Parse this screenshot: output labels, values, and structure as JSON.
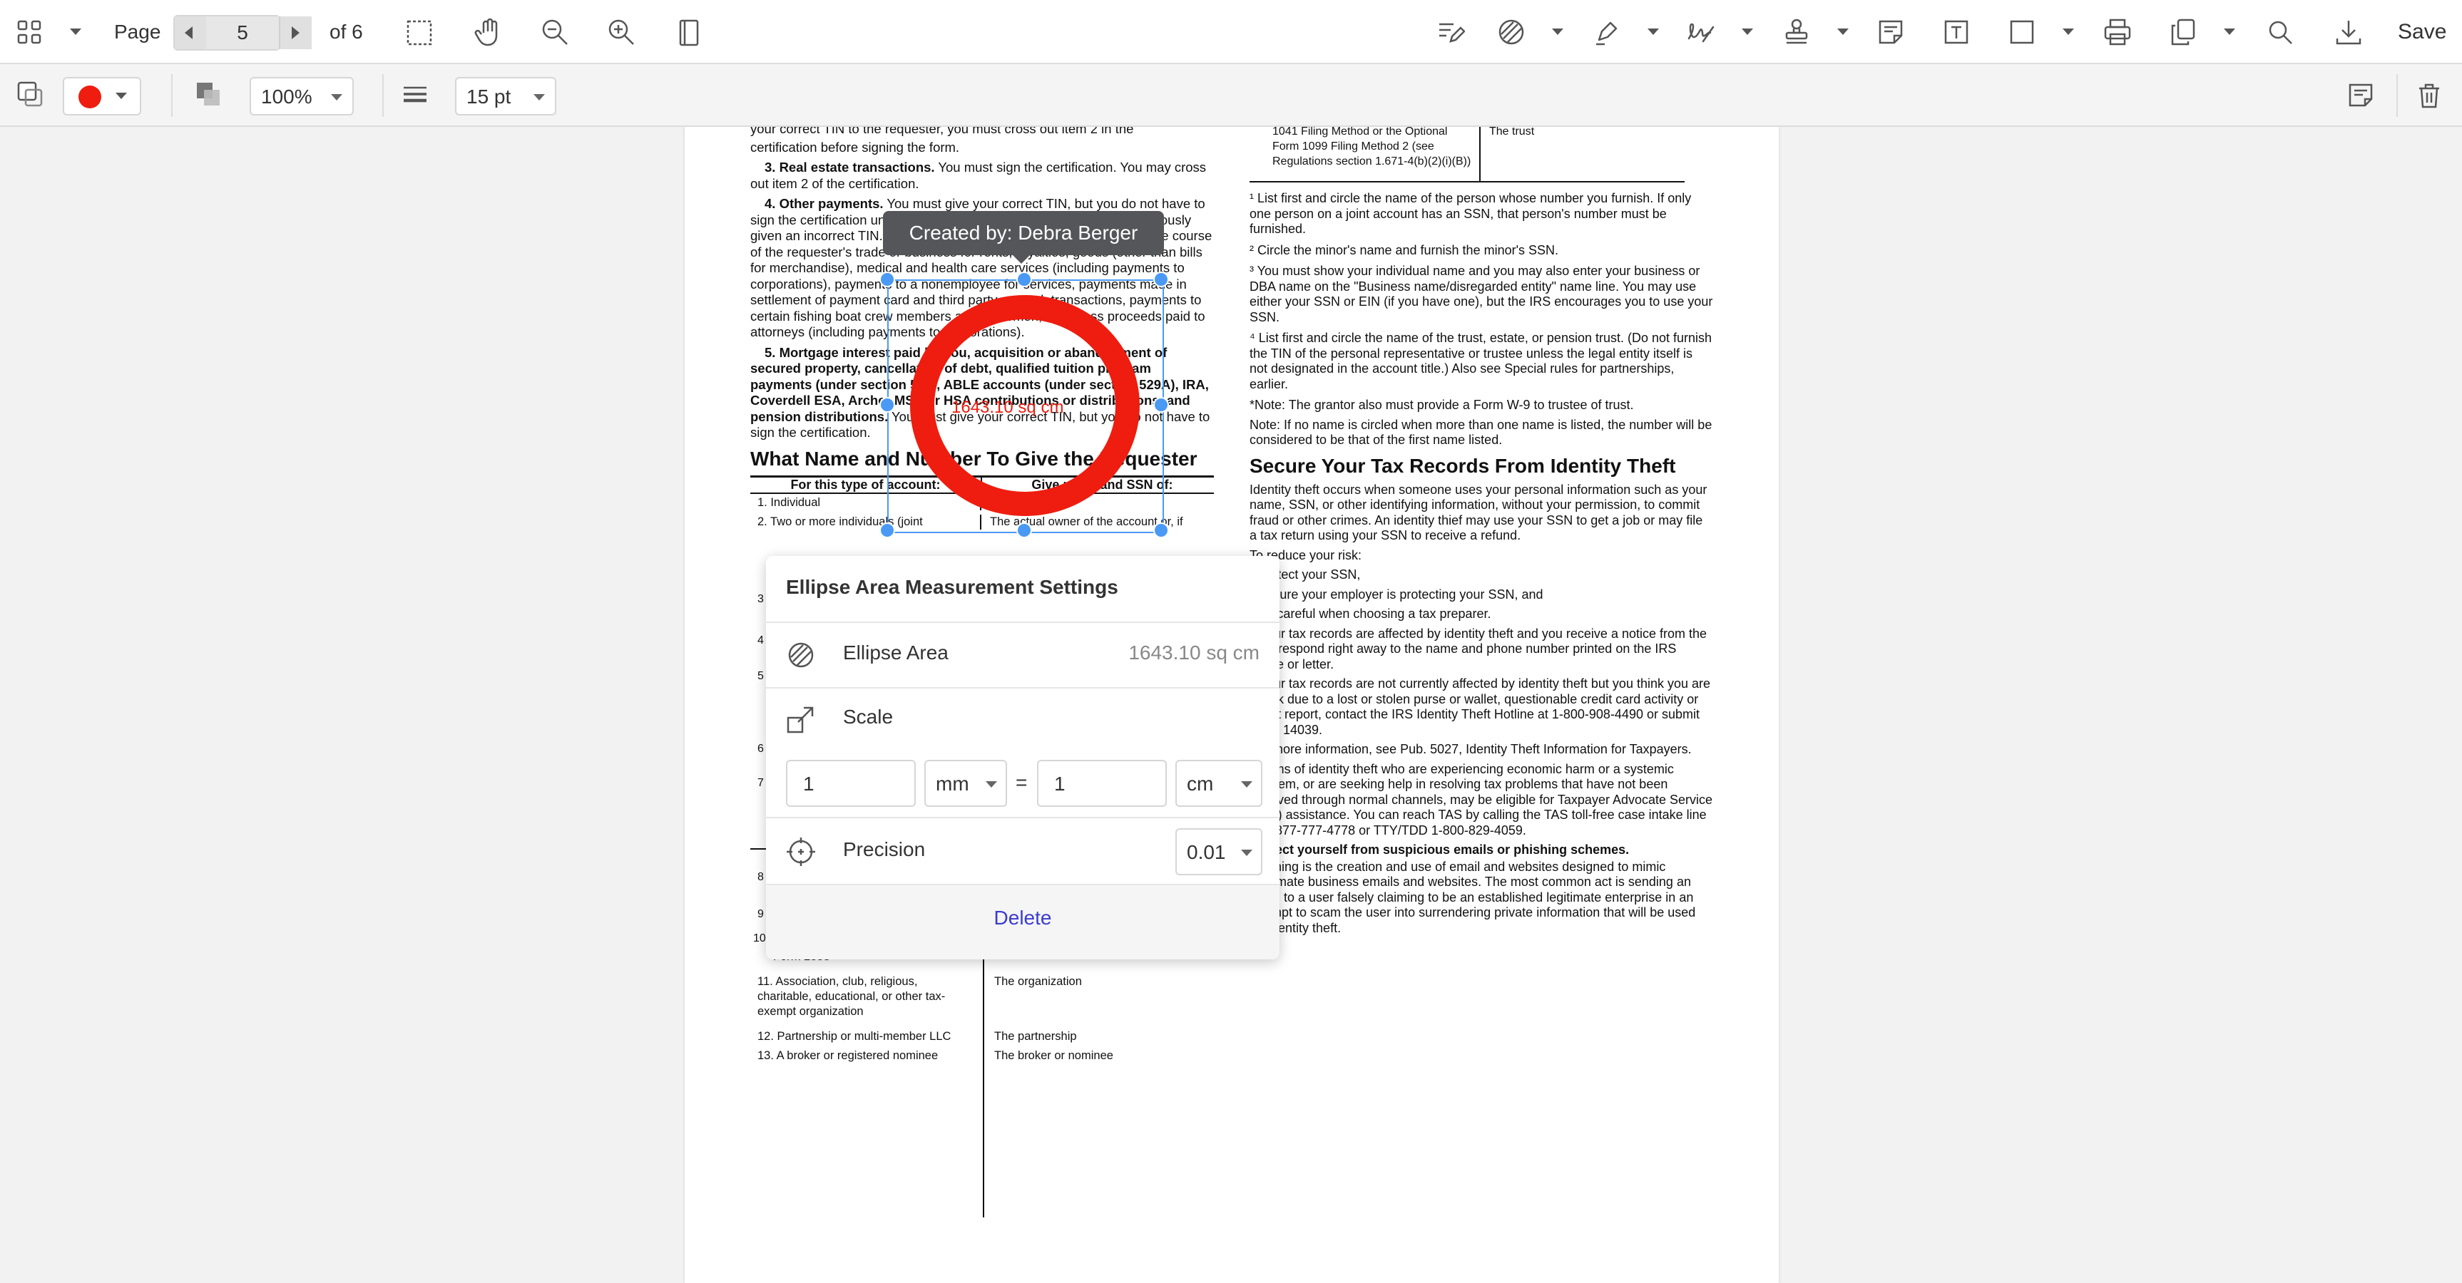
{
  "toolbar": {
    "page_label": "Page",
    "page_value": "5",
    "page_total": "of 6",
    "save_label": "Save"
  },
  "subtoolbar": {
    "stroke_color": "#ee1d0f",
    "opacity_value": "100%",
    "thickness_value": "15 pt"
  },
  "document": {
    "left_col": [
      "your correct TIN to the requester, you must cross out item 2 in the",
      "certification before signing the form."
    ],
    "real_estate_title": "3. Real estate transactions.",
    "real_estate_text": " You must sign the certification. You may cross out item 2 of the certification.",
    "other_payments_title": "4. Other payments.",
    "other_payments_text": " You must give your correct TIN, but you do not have to sign the certification unless you have been notified that you have previously given an incorrect TIN. \"Other payments\" include payments made in the course of the requester's trade or business for rents, royalties, goods (other than bills for merchandise), medical and health care services (including payments to corporations), payments to a nonemployee for services, payments made in settlement of payment card and third party network transactions, payments to certain fishing boat crew members and fishermen, and gross proceeds paid to attorneys (including payments to corporations).",
    "mortgage_title": "5. Mortgage interest paid by you, acquisition or abandonment of secured property, cancellation of debt, qualified tuition program payments (under section 529), ABLE accounts (under section 529A), IRA, Coverdell ESA, Archer MSA or HSA contributions or distributions, and pension distributions.",
    "mortgage_text": " You must give your correct TIN, but you do not have to sign the certification.",
    "what_name_heading": "What Name and Number To Give the Requester",
    "table_head_1": "For this type of account:",
    "table_head_2": "Give name and SSN of:",
    "table_rows": [
      {
        "a": "1. Individual",
        "b": "The individual"
      },
      {
        "a": "2. Two or more individuals (joint",
        "b": "The actual owner of the account or, if"
      }
    ],
    "table_rows_lower": [
      {
        "a": "Form 2553",
        "b": ""
      },
      {
        "a": "11. Association, club, religious, charitable, educational, or other tax-exempt organization",
        "b": "The organization"
      },
      {
        "a": "12. Partnership or multi-member LLC",
        "b": "The partnership"
      },
      {
        "a": "13. A broker or registered nominee",
        "b": "The broker or nominee"
      }
    ],
    "right_top": "1041 Filing Method or the Optional Form 1099 Filing Method 2 (see Regulations section 1.671-4(b)(2)(i)(B))",
    "right_top_col2": "The trust",
    "note1": "¹ List first and circle the name of the person whose number you furnish. If only one person on a joint account has an SSN, that person's number must be furnished.",
    "note2": "² Circle the minor's name and furnish the minor's SSN.",
    "note3": "³ You must show your individual name and you may also enter your business or DBA name on the \"Business name/disregarded entity\" name line. You may use either your SSN or EIN (if you have one), but the IRS encourages you to use your SSN.",
    "note4": "⁴ List first and circle the name of the trust, estate, or pension trust. (Do not furnish the TIN of the personal representative or trustee unless the legal entity itself is not designated in the account title.) Also see Special rules for partnerships, earlier.",
    "note5": "*Note: The grantor also must provide a Form W-9 to trustee of trust.",
    "note6": "Note: If no name is circled when more than one name is listed, the number will be considered to be that of the first name listed.",
    "secure_heading": "Secure Your Tax Records From Identity Theft",
    "secure_p1": "Identity theft occurs when someone uses your personal information such as your name, SSN, or other identifying information, without your permission, to commit fraud or other crimes. An identity thief may use your SSN to get a job or may file a tax return using your SSN to receive a refund.",
    "secure_p2": "To reduce your risk:",
    "secure_p3": "• Protect your SSN,",
    "secure_p4": "• Ensure your employer is protecting your SSN, and",
    "secure_p5": "• Be careful when choosing a tax preparer.",
    "secure_p6": "If your tax records are affected by identity theft and you receive a notice from the IRS, respond right away to the name and phone number printed on the IRS notice or letter.",
    "secure_p7": "If your tax records are not currently affected by identity theft but you think you are at risk due to a lost or stolen purse or wallet, questionable credit card activity or credit report, contact the IRS Identity Theft Hotline at 1-800-908-4490 or submit Form 14039.",
    "secure_p8": "For more information, see Pub. 5027, Identity Theft Information for Taxpayers.",
    "secure_p9": "Victims of identity theft who are experiencing economic harm or a systemic problem, or are seeking help in resolving tax problems that have not been resolved through normal channels, may be eligible for Taxpayer Advocate Service (TAS) assistance. You can reach TAS by calling the TAS toll-free case intake line at 1-877-777-4778 or TTY/TDD 1-800-829-4059.",
    "secure_p10": "Protect yourself from suspicious emails or phishing schemes.",
    "secure_p11": "Phishing is the creation and use of email and websites designed to mimic legitimate business emails and websites. The most common act is sending an email to a user falsely claiming to be an established legitimate enterprise in an attempt to scam the user into surrendering private information that will be used for identity theft.",
    "lower_left_numbers": [
      "3",
      "4",
      "5",
      "6",
      "7",
      "8",
      "9",
      "10"
    ]
  },
  "annotation": {
    "tooltip": "Created by: Debra Berger",
    "measure_label": "1643.10 sq cm",
    "ring_color": "#ee1d0f",
    "selection_color": "#4a9af5"
  },
  "popup": {
    "title": "Ellipse Area Measurement Settings",
    "area_label": "Ellipse Area",
    "area_value": "1643.10 sq cm",
    "scale_label": "Scale",
    "scale_from_value": "1",
    "scale_from_unit": "mm",
    "equals": "=",
    "scale_to_value": "1",
    "scale_to_unit": "cm",
    "precision_label": "Precision",
    "precision_value": "0.01",
    "delete_label": "Delete"
  }
}
